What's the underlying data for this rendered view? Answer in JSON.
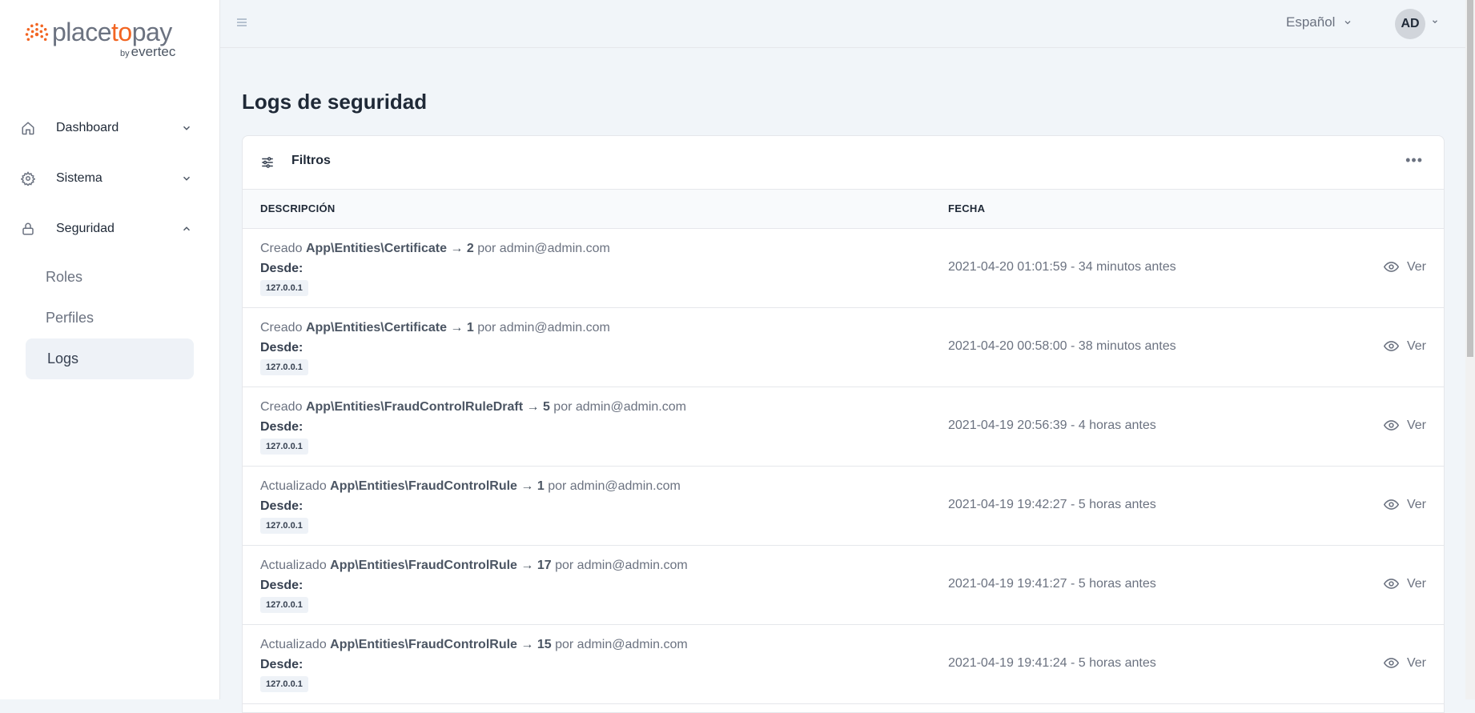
{
  "logo": {
    "brand_prefix": "place",
    "brand_accent": "to",
    "brand_suffix": "pay",
    "by": "by",
    "company": "evertec"
  },
  "sidebar": {
    "items": [
      {
        "label": "Dashboard",
        "icon": "home-icon",
        "expanded": false
      },
      {
        "label": "Sistema",
        "icon": "gear-icon",
        "expanded": false
      },
      {
        "label": "Seguridad",
        "icon": "lock-icon",
        "expanded": true
      }
    ],
    "sub_items": [
      {
        "label": "Roles",
        "active": false
      },
      {
        "label": "Perfiles",
        "active": false
      },
      {
        "label": "Logs",
        "active": true
      }
    ]
  },
  "topbar": {
    "language": "Español",
    "avatar_initials": "AD"
  },
  "page": {
    "title": "Logs de seguridad"
  },
  "filters": {
    "label": "Filtros",
    "more": "•••"
  },
  "table": {
    "columns": [
      "DESCRIPCIÓN",
      "FECHA"
    ],
    "desde_label": "Desde:",
    "view_label": "Ver",
    "rows": [
      {
        "action": "Creado",
        "entity": "App\\Entities\\Certificate → 2",
        "by": "por admin@admin.com",
        "ip": "127.0.0.1",
        "date": "2021-04-20 01:01:59 - 34 minutos antes"
      },
      {
        "action": "Creado",
        "entity": "App\\Entities\\Certificate → 1",
        "by": "por admin@admin.com",
        "ip": "127.0.0.1",
        "date": "2021-04-20 00:58:00 - 38 minutos antes"
      },
      {
        "action": "Creado",
        "entity": "App\\Entities\\FraudControlRuleDraft → 5",
        "by": "por admin@admin.com",
        "ip": "127.0.0.1",
        "date": "2021-04-19 20:56:39 - 4 horas antes"
      },
      {
        "action": "Actualizado",
        "entity": "App\\Entities\\FraudControlRule → 1",
        "by": "por admin@admin.com",
        "ip": "127.0.0.1",
        "date": "2021-04-19 19:42:27 - 5 horas antes"
      },
      {
        "action": "Actualizado",
        "entity": "App\\Entities\\FraudControlRule → 17",
        "by": "por admin@admin.com",
        "ip": "127.0.0.1",
        "date": "2021-04-19 19:41:27 - 5 horas antes"
      },
      {
        "action": "Actualizado",
        "entity": "App\\Entities\\FraudControlRule → 15",
        "by": "por admin@admin.com",
        "ip": "127.0.0.1",
        "date": "2021-04-19 19:41:24 - 5 horas antes"
      }
    ]
  },
  "colors": {
    "brand_orange": "#f26522",
    "sidebar_active_bg": "#eef2f7",
    "page_bg": "#f1f5f9"
  }
}
